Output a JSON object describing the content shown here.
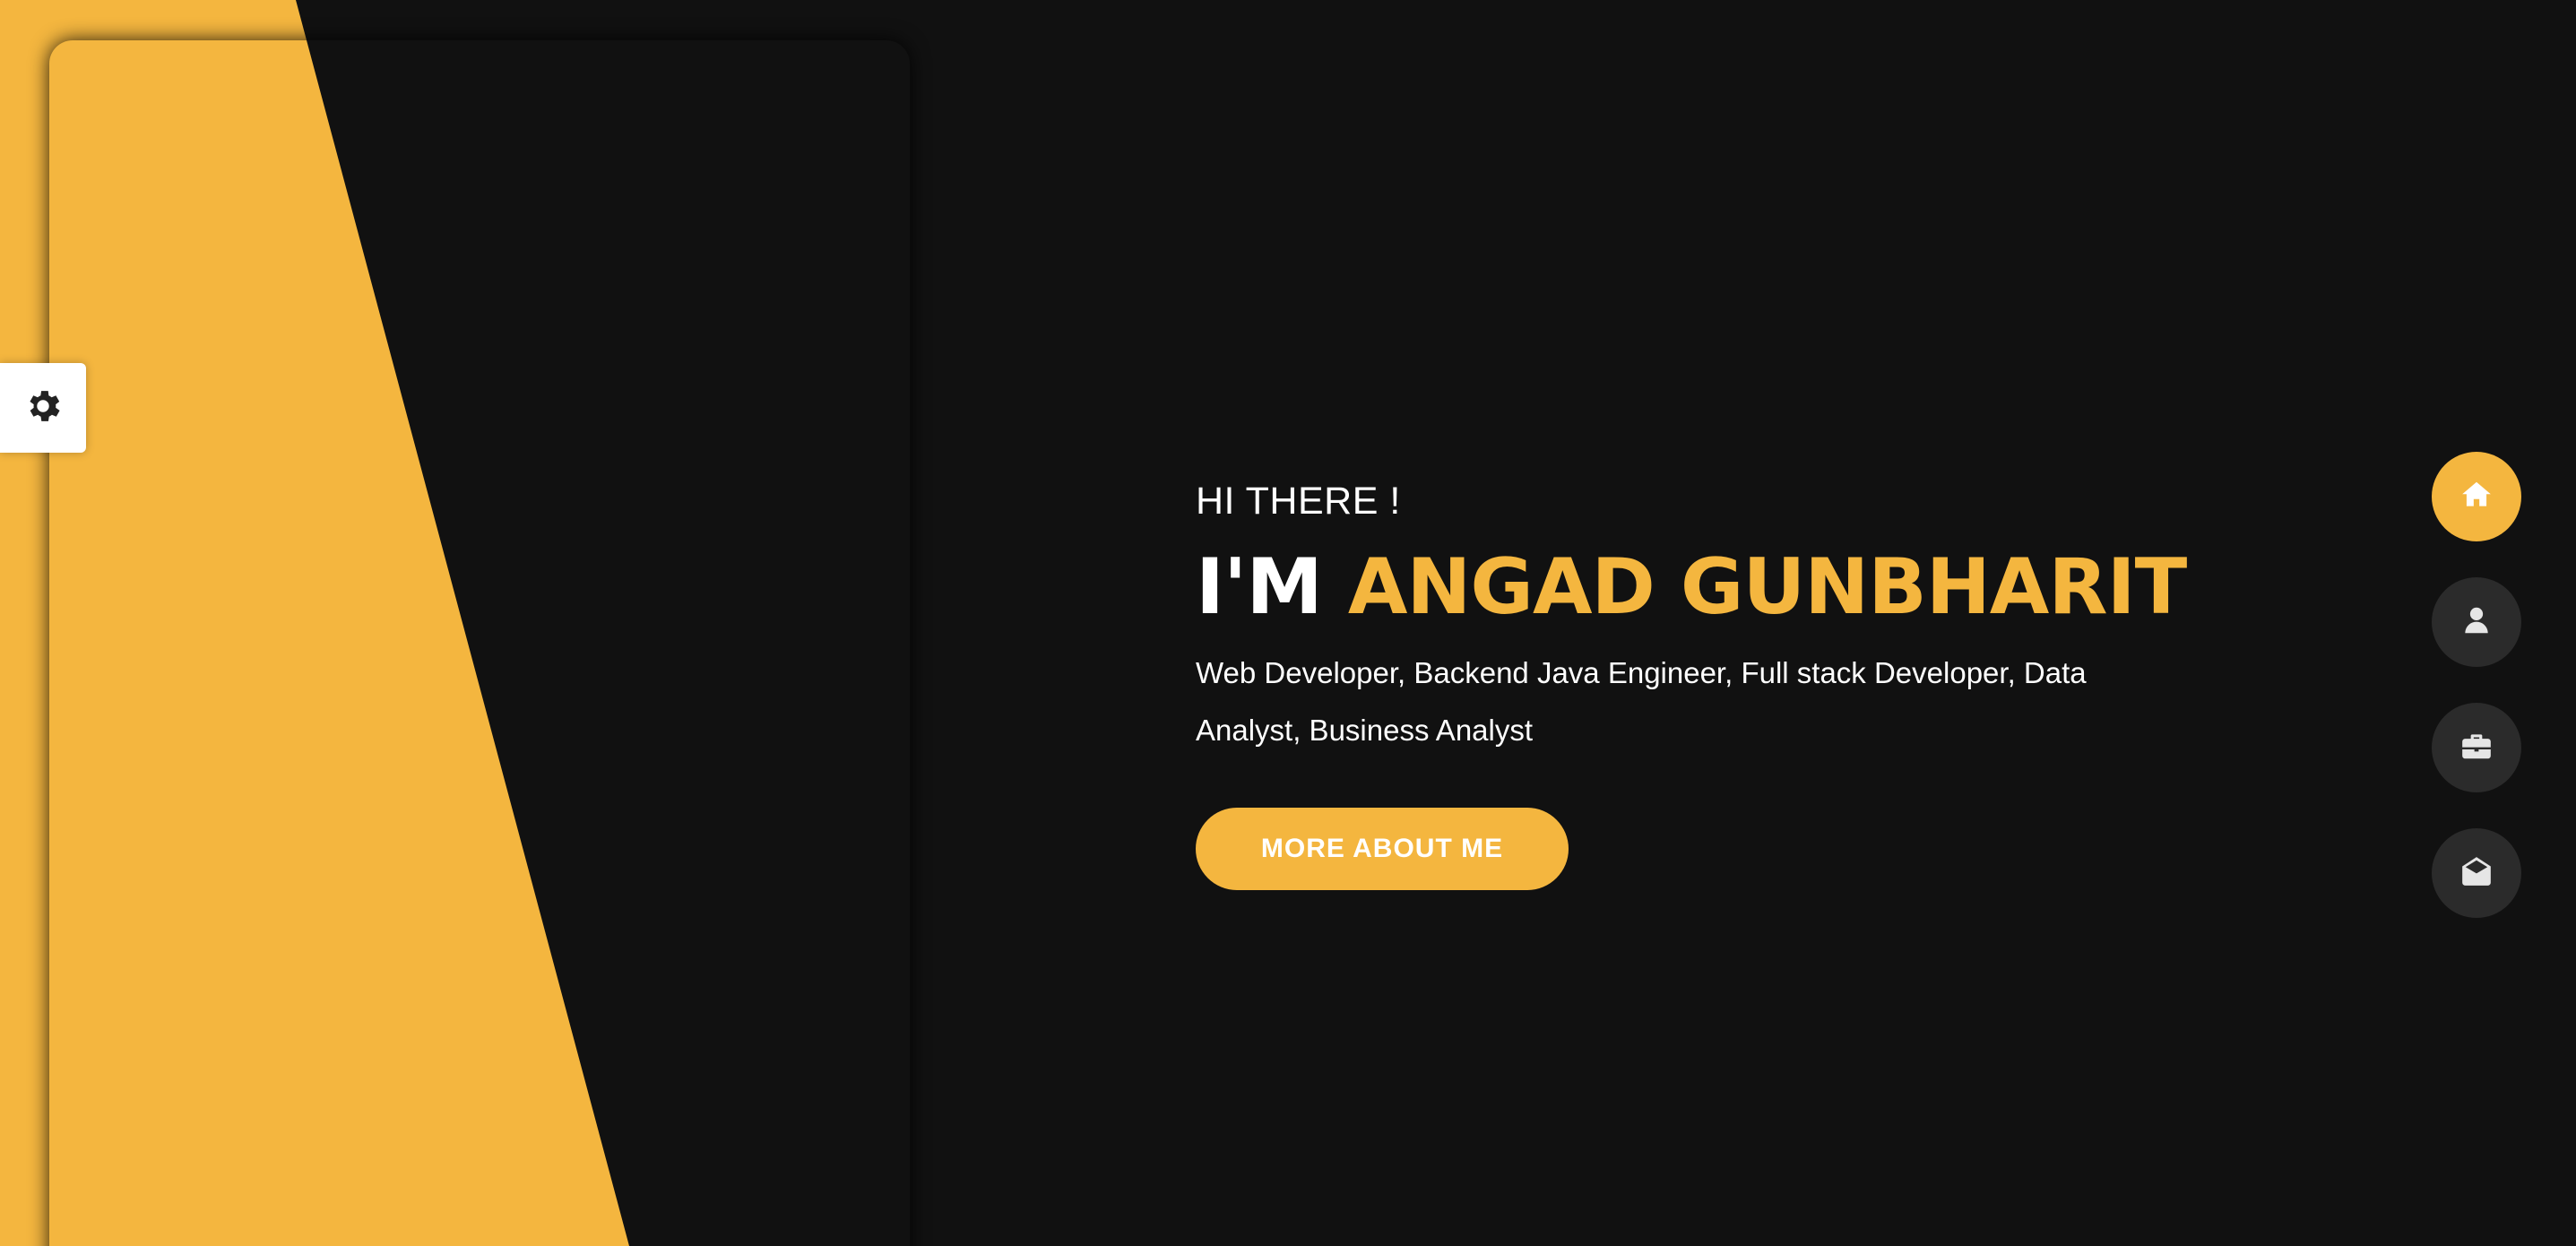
{
  "colors": {
    "accent": "#f4b63f",
    "background": "#111111",
    "nav_button": "#2b2b2b",
    "text": "#ffffff"
  },
  "settings": {
    "icon": "gear-icon"
  },
  "hero": {
    "greeting": "HI THERE !",
    "prefix": "I'M",
    "name": "ANGAD GUNBHARIT",
    "roles": "Web Developer, Backend Java Engineer, Full stack Developer, Data Analyst, Business Analyst",
    "cta_label": "MORE ABOUT ME"
  },
  "nav": {
    "items": [
      {
        "icon": "home-icon",
        "active": true
      },
      {
        "icon": "user-icon",
        "active": false
      },
      {
        "icon": "briefcase-icon",
        "active": false
      },
      {
        "icon": "envelope-open-icon",
        "active": false
      }
    ]
  }
}
